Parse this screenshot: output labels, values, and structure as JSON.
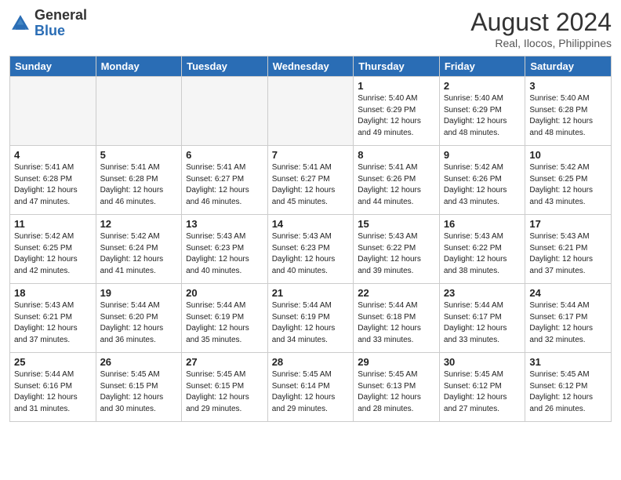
{
  "header": {
    "logo_general": "General",
    "logo_blue": "Blue",
    "month_year": "August 2024",
    "location": "Real, Ilocos, Philippines"
  },
  "days_of_week": [
    "Sunday",
    "Monday",
    "Tuesday",
    "Wednesday",
    "Thursday",
    "Friday",
    "Saturday"
  ],
  "weeks": [
    [
      {
        "day": "",
        "info": ""
      },
      {
        "day": "",
        "info": ""
      },
      {
        "day": "",
        "info": ""
      },
      {
        "day": "",
        "info": ""
      },
      {
        "day": "1",
        "info": "Sunrise: 5:40 AM\nSunset: 6:29 PM\nDaylight: 12 hours\nand 49 minutes."
      },
      {
        "day": "2",
        "info": "Sunrise: 5:40 AM\nSunset: 6:29 PM\nDaylight: 12 hours\nand 48 minutes."
      },
      {
        "day": "3",
        "info": "Sunrise: 5:40 AM\nSunset: 6:28 PM\nDaylight: 12 hours\nand 48 minutes."
      }
    ],
    [
      {
        "day": "4",
        "info": "Sunrise: 5:41 AM\nSunset: 6:28 PM\nDaylight: 12 hours\nand 47 minutes."
      },
      {
        "day": "5",
        "info": "Sunrise: 5:41 AM\nSunset: 6:28 PM\nDaylight: 12 hours\nand 46 minutes."
      },
      {
        "day": "6",
        "info": "Sunrise: 5:41 AM\nSunset: 6:27 PM\nDaylight: 12 hours\nand 46 minutes."
      },
      {
        "day": "7",
        "info": "Sunrise: 5:41 AM\nSunset: 6:27 PM\nDaylight: 12 hours\nand 45 minutes."
      },
      {
        "day": "8",
        "info": "Sunrise: 5:41 AM\nSunset: 6:26 PM\nDaylight: 12 hours\nand 44 minutes."
      },
      {
        "day": "9",
        "info": "Sunrise: 5:42 AM\nSunset: 6:26 PM\nDaylight: 12 hours\nand 43 minutes."
      },
      {
        "day": "10",
        "info": "Sunrise: 5:42 AM\nSunset: 6:25 PM\nDaylight: 12 hours\nand 43 minutes."
      }
    ],
    [
      {
        "day": "11",
        "info": "Sunrise: 5:42 AM\nSunset: 6:25 PM\nDaylight: 12 hours\nand 42 minutes."
      },
      {
        "day": "12",
        "info": "Sunrise: 5:42 AM\nSunset: 6:24 PM\nDaylight: 12 hours\nand 41 minutes."
      },
      {
        "day": "13",
        "info": "Sunrise: 5:43 AM\nSunset: 6:23 PM\nDaylight: 12 hours\nand 40 minutes."
      },
      {
        "day": "14",
        "info": "Sunrise: 5:43 AM\nSunset: 6:23 PM\nDaylight: 12 hours\nand 40 minutes."
      },
      {
        "day": "15",
        "info": "Sunrise: 5:43 AM\nSunset: 6:22 PM\nDaylight: 12 hours\nand 39 minutes."
      },
      {
        "day": "16",
        "info": "Sunrise: 5:43 AM\nSunset: 6:22 PM\nDaylight: 12 hours\nand 38 minutes."
      },
      {
        "day": "17",
        "info": "Sunrise: 5:43 AM\nSunset: 6:21 PM\nDaylight: 12 hours\nand 37 minutes."
      }
    ],
    [
      {
        "day": "18",
        "info": "Sunrise: 5:43 AM\nSunset: 6:21 PM\nDaylight: 12 hours\nand 37 minutes."
      },
      {
        "day": "19",
        "info": "Sunrise: 5:44 AM\nSunset: 6:20 PM\nDaylight: 12 hours\nand 36 minutes."
      },
      {
        "day": "20",
        "info": "Sunrise: 5:44 AM\nSunset: 6:19 PM\nDaylight: 12 hours\nand 35 minutes."
      },
      {
        "day": "21",
        "info": "Sunrise: 5:44 AM\nSunset: 6:19 PM\nDaylight: 12 hours\nand 34 minutes."
      },
      {
        "day": "22",
        "info": "Sunrise: 5:44 AM\nSunset: 6:18 PM\nDaylight: 12 hours\nand 33 minutes."
      },
      {
        "day": "23",
        "info": "Sunrise: 5:44 AM\nSunset: 6:17 PM\nDaylight: 12 hours\nand 33 minutes."
      },
      {
        "day": "24",
        "info": "Sunrise: 5:44 AM\nSunset: 6:17 PM\nDaylight: 12 hours\nand 32 minutes."
      }
    ],
    [
      {
        "day": "25",
        "info": "Sunrise: 5:44 AM\nSunset: 6:16 PM\nDaylight: 12 hours\nand 31 minutes."
      },
      {
        "day": "26",
        "info": "Sunrise: 5:45 AM\nSunset: 6:15 PM\nDaylight: 12 hours\nand 30 minutes."
      },
      {
        "day": "27",
        "info": "Sunrise: 5:45 AM\nSunset: 6:15 PM\nDaylight: 12 hours\nand 29 minutes."
      },
      {
        "day": "28",
        "info": "Sunrise: 5:45 AM\nSunset: 6:14 PM\nDaylight: 12 hours\nand 29 minutes."
      },
      {
        "day": "29",
        "info": "Sunrise: 5:45 AM\nSunset: 6:13 PM\nDaylight: 12 hours\nand 28 minutes."
      },
      {
        "day": "30",
        "info": "Sunrise: 5:45 AM\nSunset: 6:12 PM\nDaylight: 12 hours\nand 27 minutes."
      },
      {
        "day": "31",
        "info": "Sunrise: 5:45 AM\nSunset: 6:12 PM\nDaylight: 12 hours\nand 26 minutes."
      }
    ]
  ]
}
